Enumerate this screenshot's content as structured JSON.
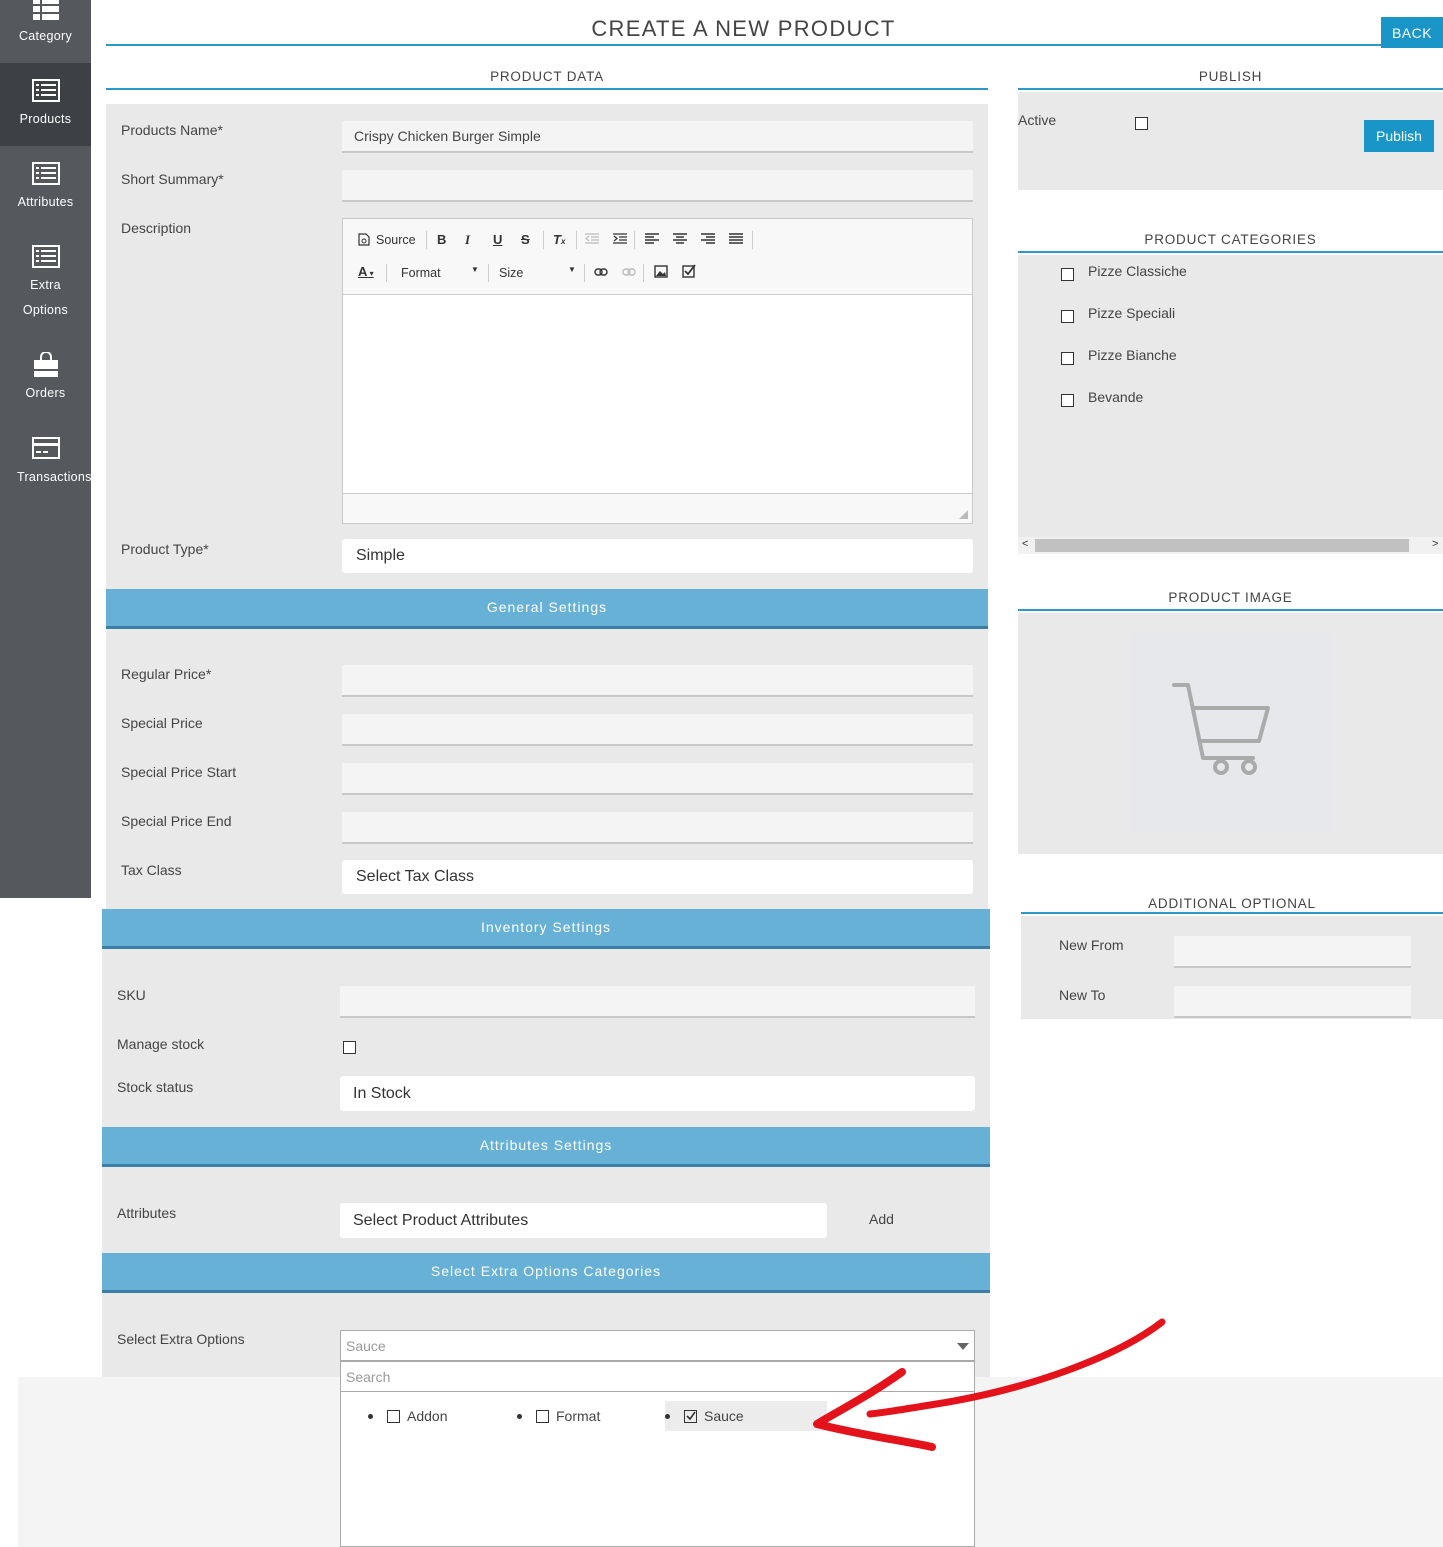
{
  "sidebar": {
    "items": [
      {
        "label": "Category",
        "icon": "grid-list-icon"
      },
      {
        "label": "Products",
        "icon": "list-icon"
      },
      {
        "label": "Attributes",
        "icon": "list-icon"
      },
      {
        "label": "Extra",
        "label2": "Options",
        "icon": "list-icon"
      },
      {
        "label": "Orders",
        "icon": "shopping-bag-icon"
      },
      {
        "label": "Transactions",
        "icon": "credit-card-icon"
      }
    ]
  },
  "header": {
    "title": "CREATE A NEW PRODUCT",
    "back_label": "BACK"
  },
  "product_data": {
    "heading": "PRODUCT DATA",
    "name_label": "Products Name*",
    "name_value": "Crispy Chicken Burger Simple",
    "summary_label": "Short Summary*",
    "summary_value": "",
    "description_label": "Description",
    "type_label": "Product Type*",
    "type_value": "Simple"
  },
  "editor": {
    "source_label": "Source",
    "format_label": "Format",
    "size_label": "Size"
  },
  "general": {
    "heading": "General Settings",
    "regular_price_label": "Regular Price*",
    "special_price_label": "Special Price",
    "special_start_label": "Special Price Start",
    "special_end_label": "Special Price End",
    "tax_label": "Tax Class",
    "tax_value": "Select Tax Class"
  },
  "inventory": {
    "heading": "Inventory Settings",
    "sku_label": "SKU",
    "manage_label": "Manage stock",
    "status_label": "Stock status",
    "status_value": "In Stock"
  },
  "attributes": {
    "heading": "Attributes Settings",
    "label": "Attributes",
    "select_value": "Select Product Attributes",
    "add_label": "Add"
  },
  "extra": {
    "heading": "Select Extra Options Categories",
    "label": "Select Extra Options",
    "selected": "Sauce",
    "search_placeholder": "Search",
    "options": [
      {
        "label": "Addon",
        "checked": false
      },
      {
        "label": "Format",
        "checked": false
      },
      {
        "label": "Sauce",
        "checked": true
      }
    ]
  },
  "publish": {
    "heading": "PUBLISH",
    "active_label": "Active",
    "button_label": "Publish"
  },
  "categories": {
    "heading": "PRODUCT CATEGORIES",
    "items": [
      "Pizze Classiche",
      "Pizze Speciali",
      "Pizze Bianche",
      "Bevande"
    ]
  },
  "image": {
    "heading": "PRODUCT IMAGE",
    "icon": "shopping-cart-icon"
  },
  "additional": {
    "heading": "ADDITIONAL OPTIONAL",
    "new_from_label": "New From",
    "new_to_label": "New To"
  },
  "colors": {
    "accent": "#1a95c8",
    "section": "#67b1d6",
    "annotation": "#e3121b",
    "sidebar": "#55585d"
  }
}
